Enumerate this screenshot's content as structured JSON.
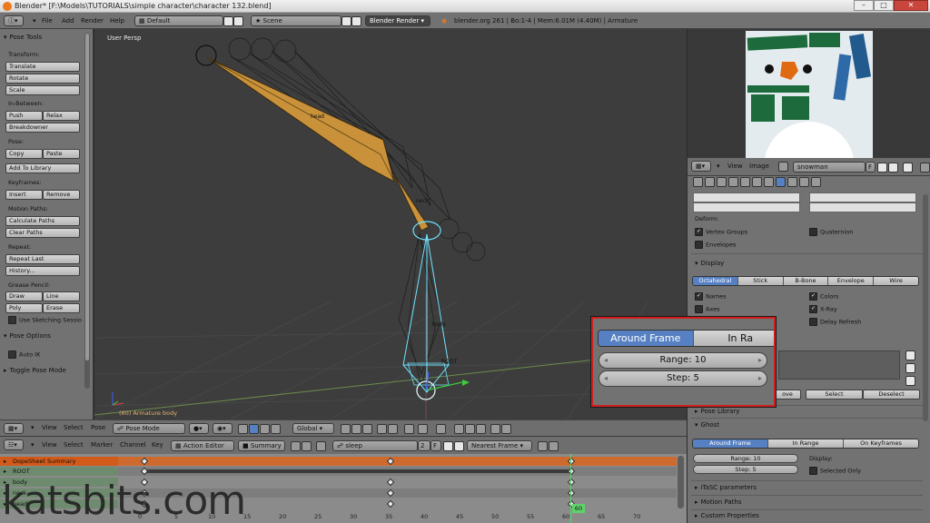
{
  "window": {
    "title": "Blender* [F:\\Models\\TUTORIALS\\simple character\\character 132.blend]",
    "controls": [
      "–",
      "□",
      "✕"
    ]
  },
  "info_header": {
    "menus": [
      "File",
      "Add",
      "Render",
      "Help"
    ],
    "screen_layout": "Default",
    "scene": "Scene",
    "render_engine": "Blender Render",
    "stats": "blender.org 261 | Bo:1-4 | Mem:6.01M (4.40M) | Armature"
  },
  "tool_shelf": {
    "title": "Pose Tools",
    "sections": {
      "transform": {
        "label": "Transform:",
        "buttons": [
          "Translate",
          "Rotate",
          "Scale"
        ]
      },
      "in_between": {
        "label": "In-Between:",
        "buttons": [
          "Push",
          "Relax",
          "Breakdowner"
        ]
      },
      "pose": {
        "label": "Pose:",
        "buttons": [
          "Copy",
          "Paste",
          "Add To Library"
        ]
      },
      "keyframes": {
        "label": "Keyframes:",
        "buttons": [
          "Insert",
          "Remove"
        ]
      },
      "motion_paths": {
        "label": "Motion Paths:",
        "buttons": [
          "Calculate Paths",
          "Clear Paths"
        ]
      },
      "repeat": {
        "label": "Repeat:",
        "buttons": [
          "Repeat Last",
          "History..."
        ]
      },
      "grease_pencil": {
        "label": "Grease Pencil:",
        "buttons": [
          "Draw",
          "Line",
          "Poly",
          "Erase"
        ],
        "checkbox": "Use Sketching Sessio"
      }
    },
    "pose_options": {
      "title": "Pose Options",
      "auto_ik": "Auto IK"
    },
    "toggle_pose_mode": "Toggle Pose Mode"
  },
  "viewport": {
    "view_label": "User Persp",
    "status": "(60) Armature body",
    "bone_labels": [
      "head",
      "neck",
      "body",
      "ROOT"
    ]
  },
  "view3d_header": {
    "menus": [
      "View",
      "Select",
      "Pose"
    ],
    "mode": "Pose Mode",
    "orientation": "Global"
  },
  "dopesheet_header": {
    "menus": [
      "View",
      "Select",
      "Marker",
      "Channel",
      "Key"
    ],
    "editor_mode": "Action Editor",
    "summary_toggle": "Summary",
    "action_name": "sleep",
    "action_users": "2",
    "action_fake": "F",
    "snap": "Nearest Frame"
  },
  "dopesheet": {
    "channels": [
      "DopeSheet Summary",
      "ROOT",
      "body",
      "neck",
      "head"
    ],
    "frame_ticks": [
      "0",
      "5",
      "10",
      "15",
      "20",
      "25",
      "30",
      "35",
      "40",
      "45",
      "50",
      "55",
      "60",
      "65",
      "70"
    ],
    "current_frame": "60"
  },
  "image_editor": {
    "menus": [
      "View",
      "Image"
    ],
    "image_name": "snowman",
    "image_fake": "F"
  },
  "properties": {
    "deform": {
      "label": "Deform:",
      "vertex_groups": "Vertex Groups",
      "envelopes": "Envelopes",
      "quaternion": "Quaternion"
    },
    "display": {
      "title": "Display",
      "draw_types": [
        "Octahedral",
        "Stick",
        "B-Bone",
        "Envelope",
        "Wire"
      ],
      "selected_draw_type": "Octahedral",
      "names": "Names",
      "axes": "Axes",
      "colors": "Colors",
      "xray": "X-Ray",
      "delay_refresh": "Delay Refresh"
    },
    "bone_group_buttons": [
      "ove",
      "Select",
      "Deselect"
    ],
    "pose_library": "Pose Library",
    "ghost": {
      "title": "Ghost",
      "types": [
        "Around Frame",
        "In Range",
        "On Keyframes"
      ],
      "selected_type": "Around Frame",
      "range": "Range: 10",
      "step": "Step: 5",
      "display_label": "Display:",
      "selected_only": "Selected Only"
    },
    "itasc": "iTaSC parameters",
    "motion_paths": "Motion Paths",
    "custom_properties": "Custom Properties"
  },
  "callout": {
    "types": [
      "Around Frame",
      "In Ra"
    ],
    "range": "Range: 10",
    "step": "Step: 5"
  },
  "watermark": "katsbits.com",
  "colors": {
    "accent_blue": "#5680c2",
    "selected_bone_cyan": "#6fe3ff",
    "bone_orange": "#c9923a",
    "callout_red": "#d21d1d",
    "current_frame_green": "#5fd16b"
  }
}
